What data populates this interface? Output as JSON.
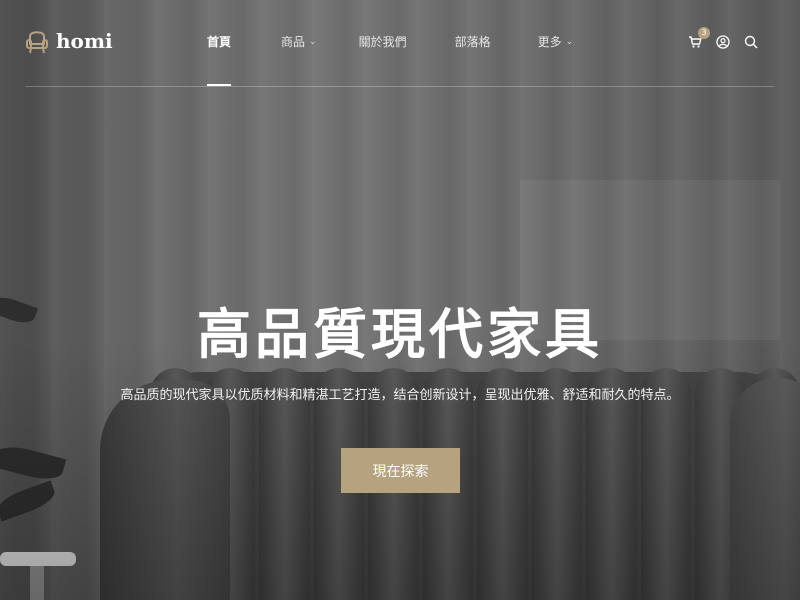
{
  "brand": {
    "name": "homi",
    "accent": "#b5a27e"
  },
  "nav": {
    "items": [
      {
        "label": "首頁",
        "active": true,
        "dropdown": false
      },
      {
        "label": "商品",
        "active": false,
        "dropdown": true
      },
      {
        "label": "關於我們",
        "active": false,
        "dropdown": false
      },
      {
        "label": "部落格",
        "active": false,
        "dropdown": false
      },
      {
        "label": "更多",
        "active": false,
        "dropdown": true
      }
    ],
    "chevron": "⌄"
  },
  "header_icons": {
    "cart": {
      "icon": "cart-icon",
      "count": "3"
    },
    "account": {
      "icon": "user-circle-icon"
    },
    "search": {
      "icon": "search-icon"
    }
  },
  "hero": {
    "title": "高品質現代家具",
    "subtitle": "高品质的现代家具以优质材料和精湛工艺打造，结合创新设计，呈现出优雅、舒适和耐久的特点。",
    "cta_label": "現在探索"
  }
}
